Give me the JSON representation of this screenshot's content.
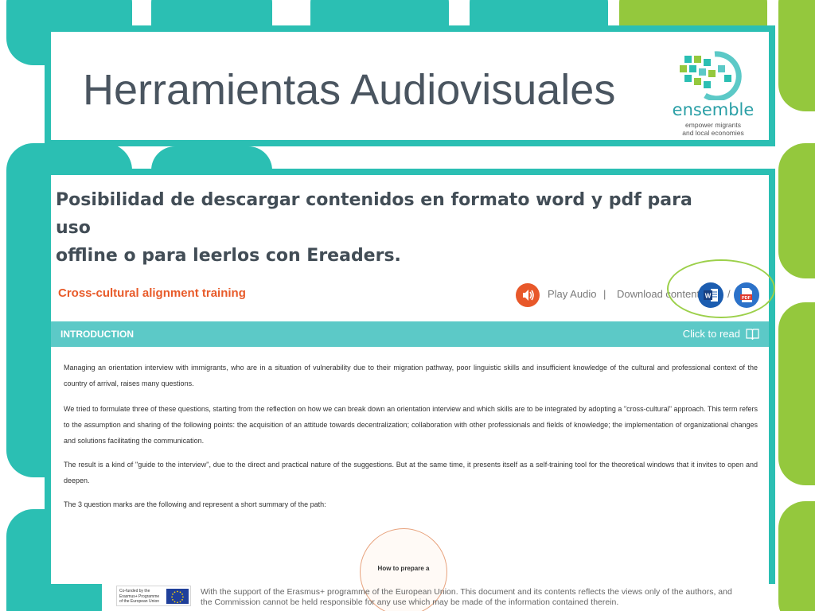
{
  "colors": {
    "teal": "#2bbfb3",
    "green": "#94c83d",
    "title_text": "#4a5560",
    "accent_orange": "#e85b2a",
    "intro_bar": "#5cc9c7",
    "word_blue": "#1c5db0",
    "pdf_blue": "#2c72c9"
  },
  "header": {
    "title": "Herramientas Audiovisuales",
    "logo": {
      "icon": "ensemble-logo-icon",
      "word": "ensemble",
      "tagline_line1": "empower migrants",
      "tagline_line2": "and local economies"
    }
  },
  "content": {
    "subtitle_line1": "Posibilidad de descargar contenidos en formato word y pdf para uso",
    "subtitle_line2": "offline o para leerlos con Ereaders."
  },
  "screenshot": {
    "course_title": "Cross-cultural alignment training",
    "play_audio_label": "Play Audio",
    "separator": "|",
    "download_label": "Download content:",
    "slash": "/",
    "word_icon_label": "W",
    "pdf_icon_label": "PDF",
    "intro_label": "INTRODUCTION",
    "click_to_read": "Click to read",
    "paragraphs": [
      "Managing an orientation interview with immigrants, who are in a situation of vulnerability due to their migration pathway, poor linguistic skills and insufficient knowledge of the cultural and professional context of the country of arrival, raises many questions.",
      "We tried to formulate three of these questions, starting from the reflection on how we can break down an orientation interview and which skills are to be integrated by adopting a \"cross-cultural\" approach. This term refers to the assumption and sharing of the following points: the acquisition of an attitude towards decentralization; collaboration with other professionals and fields of knowledge; the implementation of organizational changes and solutions facilitating the communication.",
      "The result is a kind of \"guide to the interview\", due to the direct and practical nature of the suggestions. But at the same time, it presents itself as a self-training tool for the theoretical windows that it invites to open and deepen.",
      "The 3 question marks are the following and represent a short summary of the path:"
    ],
    "circle_label": "How to prepare a"
  },
  "footer": {
    "eu_line1": "Co-funded by the",
    "eu_line2": "Erasmus+ Programme",
    "eu_line3": "of the European Union",
    "note": "With the support of the Erasmus+ programme of the European Union. This document and its contents reflects the views only of the authors, and the Commission cannot be held responsible for any use which may be made of the information contained therein."
  }
}
